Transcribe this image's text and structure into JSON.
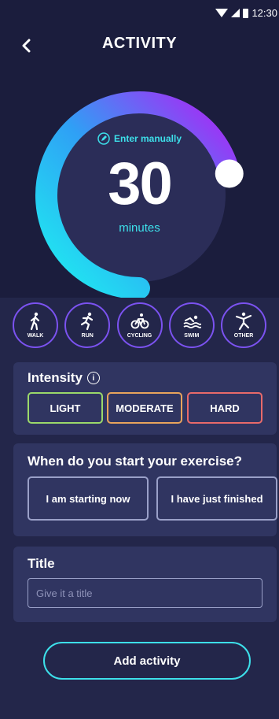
{
  "status_bar": {
    "time": "12:30"
  },
  "header": {
    "title": "ACTIVITY",
    "back_icon": "chevron-left-icon"
  },
  "dial": {
    "enter_manually_label": "Enter manually",
    "value": "30",
    "unit": "minutes",
    "fill_fraction": 0.75,
    "colors": {
      "start": "#1ef0f0",
      "end": "#b21ff5",
      "track": "#2b2d58"
    }
  },
  "activity_types": [
    {
      "label": "WALK",
      "icon": "walk-icon"
    },
    {
      "label": "RUN",
      "icon": "run-icon"
    },
    {
      "label": "CYCLING",
      "icon": "cycling-icon"
    },
    {
      "label": "SWIM",
      "icon": "swim-icon"
    },
    {
      "label": "OTHER",
      "icon": "other-icon"
    }
  ],
  "intensity": {
    "title": "Intensity",
    "levels": [
      {
        "label": "LIGHT",
        "color": "#9bd96a"
      },
      {
        "label": "MODERATE",
        "color": "#e8a45c"
      },
      {
        "label": "HARD",
        "color": "#e86a6a"
      }
    ]
  },
  "start": {
    "question": "When do you start your exercise?",
    "options": [
      "I am starting now",
      "I have just finished"
    ]
  },
  "title_field": {
    "label": "Title",
    "placeholder": "Give it a title"
  },
  "add_button": {
    "label": "Add activity"
  }
}
